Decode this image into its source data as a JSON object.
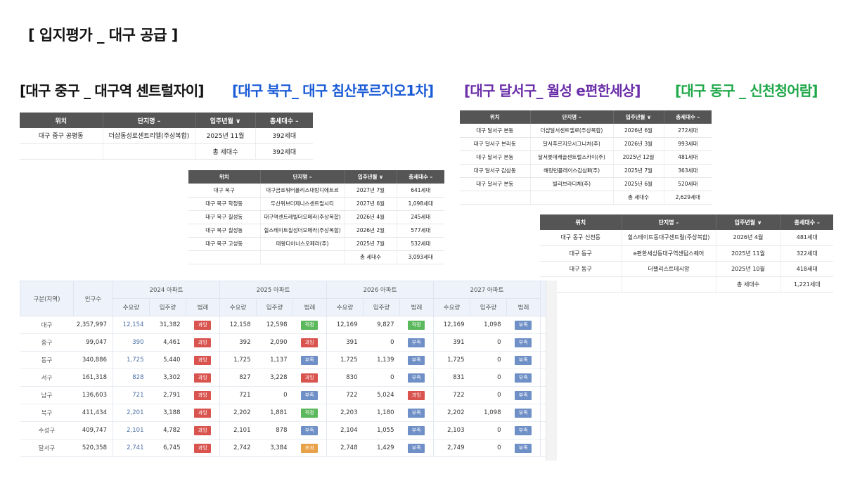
{
  "page_title": "[ 입지평가 _ 대구 공급 ]",
  "colors": {
    "black_title": "#111111",
    "buk_blue": "#1a5bd6",
    "dalseo_purple": "#6a2ea8",
    "dong_green": "#1fa84a",
    "header_gray": "#555555"
  },
  "sections": {
    "junggu": "[대구 중구 _ 대구역 센트럴자이]",
    "bukgu": "[대구 북구_ 대구 침산푸르지오1차]",
    "dalseogu": "[대구 달서구_ 월성 e편한세상]",
    "donggu": "[대구 동구 _ 신천청어람]"
  },
  "table_headers": {
    "loc": "위치",
    "complex": "단지명 –",
    "move_in": "입주년월 ∨",
    "households": "총세대수 –"
  },
  "junggu_table": {
    "rows": [
      [
        "대구 중구 공평동",
        "더샵동성로센트리엘(주상복합)",
        "2025년 11월",
        "392세대"
      ]
    ],
    "total_label": "총 세대수",
    "total_value": "392세대"
  },
  "bukgu_table": {
    "rows": [
      [
        "대구 북구",
        "대구금호워터폴리스대방디에트르",
        "2027년 7월",
        "641세대"
      ],
      [
        "대구 북구 학정동",
        "두산위브더제니스센트럴시티",
        "2027년 6월",
        "1,098세대"
      ],
      [
        "대구 북구 칠성동",
        "대구역센트레빌더오페라(주상복합)",
        "2026년 4월",
        "245세대"
      ],
      [
        "대구 북구 칠성동",
        "힐스테이트칠성더오페라(주상복합)",
        "2026년 2월",
        "577세대"
      ],
      [
        "대구 북구 고성동",
        "태왕디아너스오페라(주)",
        "2025년 7월",
        "532세대"
      ]
    ],
    "total_label": "총 세대수",
    "total_value": "3,093세대"
  },
  "dalseogu_table": {
    "rows": [
      [
        "대구 달서구 본동",
        "더샵달서센트엘로(주상복합)",
        "2026년 6월",
        "272세대"
      ],
      [
        "대구 달서구 본리동",
        "달서푸르지오시그니처(주)",
        "2026년 3월",
        "993세대"
      ],
      [
        "대구 달서구 본동",
        "달서롯데캐슬센트럴스카이(주)",
        "2025년 12월",
        "481세대"
      ],
      [
        "대구 달서구 감삼동",
        "해링턴플레이스감삼Ⅲ(주)",
        "2025년 7월",
        "363세대"
      ],
      [
        "대구 달서구 본동",
        "빌리브라디체(주)",
        "2025년 6월",
        "520세대"
      ]
    ],
    "total_label": "총 세대수",
    "total_value": "2,629세대"
  },
  "donggu_table": {
    "rows": [
      [
        "대구 동구 신천동",
        "힐스테이트동대구센트럴(주상복합)",
        "2026년 4월",
        "481세대"
      ],
      [
        "대구 동구",
        "e편한세상동대구역센텀스퀘어",
        "2025년 11월",
        "322세대"
      ],
      [
        "대구 동구",
        "더팰리스트데시앙",
        "2025년 10월",
        "418세대"
      ]
    ],
    "total_label": "총 세대수",
    "total_value": "1,221세대"
  },
  "supply_table": {
    "header_region": "구분(지역)",
    "header_pop": "인구수",
    "years": [
      "2024 아파트",
      "2025 아파트",
      "2026 아파트",
      "2027 아파트"
    ],
    "sub": {
      "demand": "수요량",
      "supply": "입주량",
      "legend": "범례"
    },
    "legend_labels": {
      "over": "과잉",
      "ok": "적정",
      "lack": "부족",
      "exc": "초과"
    },
    "rows": [
      {
        "region": "대구",
        "pop": "2,357,997",
        "y": [
          [
            "12,154",
            "31,382",
            "over"
          ],
          [
            "12,158",
            "12,598",
            "ok"
          ],
          [
            "12,169",
            "9,827",
            "ok"
          ],
          [
            "12,169",
            "1,098",
            "lack"
          ]
        ]
      },
      {
        "region": "중구",
        "pop": "99,047",
        "y": [
          [
            "390",
            "4,461",
            "over"
          ],
          [
            "392",
            "2,090",
            "over"
          ],
          [
            "391",
            "0",
            "lack"
          ],
          [
            "391",
            "0",
            "lack"
          ]
        ]
      },
      {
        "region": "동구",
        "pop": "340,886",
        "y": [
          [
            "1,725",
            "5,440",
            "over"
          ],
          [
            "1,725",
            "1,137",
            "lack"
          ],
          [
            "1,725",
            "1,139",
            "lack"
          ],
          [
            "1,725",
            "0",
            "lack"
          ]
        ]
      },
      {
        "region": "서구",
        "pop": "161,318",
        "y": [
          [
            "828",
            "3,302",
            "over"
          ],
          [
            "827",
            "3,228",
            "over"
          ],
          [
            "830",
            "0",
            "lack"
          ],
          [
            "831",
            "0",
            "lack"
          ]
        ]
      },
      {
        "region": "남구",
        "pop": "136,603",
        "y": [
          [
            "721",
            "2,791",
            "over"
          ],
          [
            "721",
            "0",
            "lack"
          ],
          [
            "722",
            "5,024",
            "over"
          ],
          [
            "722",
            "0",
            "lack"
          ]
        ]
      },
      {
        "region": "북구",
        "pop": "411,434",
        "y": [
          [
            "2,201",
            "3,188",
            "over"
          ],
          [
            "2,202",
            "1,881",
            "ok"
          ],
          [
            "2,203",
            "1,180",
            "lack"
          ],
          [
            "2,202",
            "1,098",
            "lack"
          ]
        ]
      },
      {
        "region": "수성구",
        "pop": "409,747",
        "y": [
          [
            "2,101",
            "4,782",
            "over"
          ],
          [
            "2,101",
            "878",
            "lack"
          ],
          [
            "2,104",
            "1,055",
            "lack"
          ],
          [
            "2,103",
            "0",
            "lack"
          ]
        ]
      },
      {
        "region": "달서구",
        "pop": "520,358",
        "y": [
          [
            "2,741",
            "6,745",
            "over"
          ],
          [
            "2,742",
            "3,384",
            "exc"
          ],
          [
            "2,748",
            "1,429",
            "lack"
          ],
          [
            "2,749",
            "0",
            "lack"
          ]
        ]
      }
    ]
  }
}
